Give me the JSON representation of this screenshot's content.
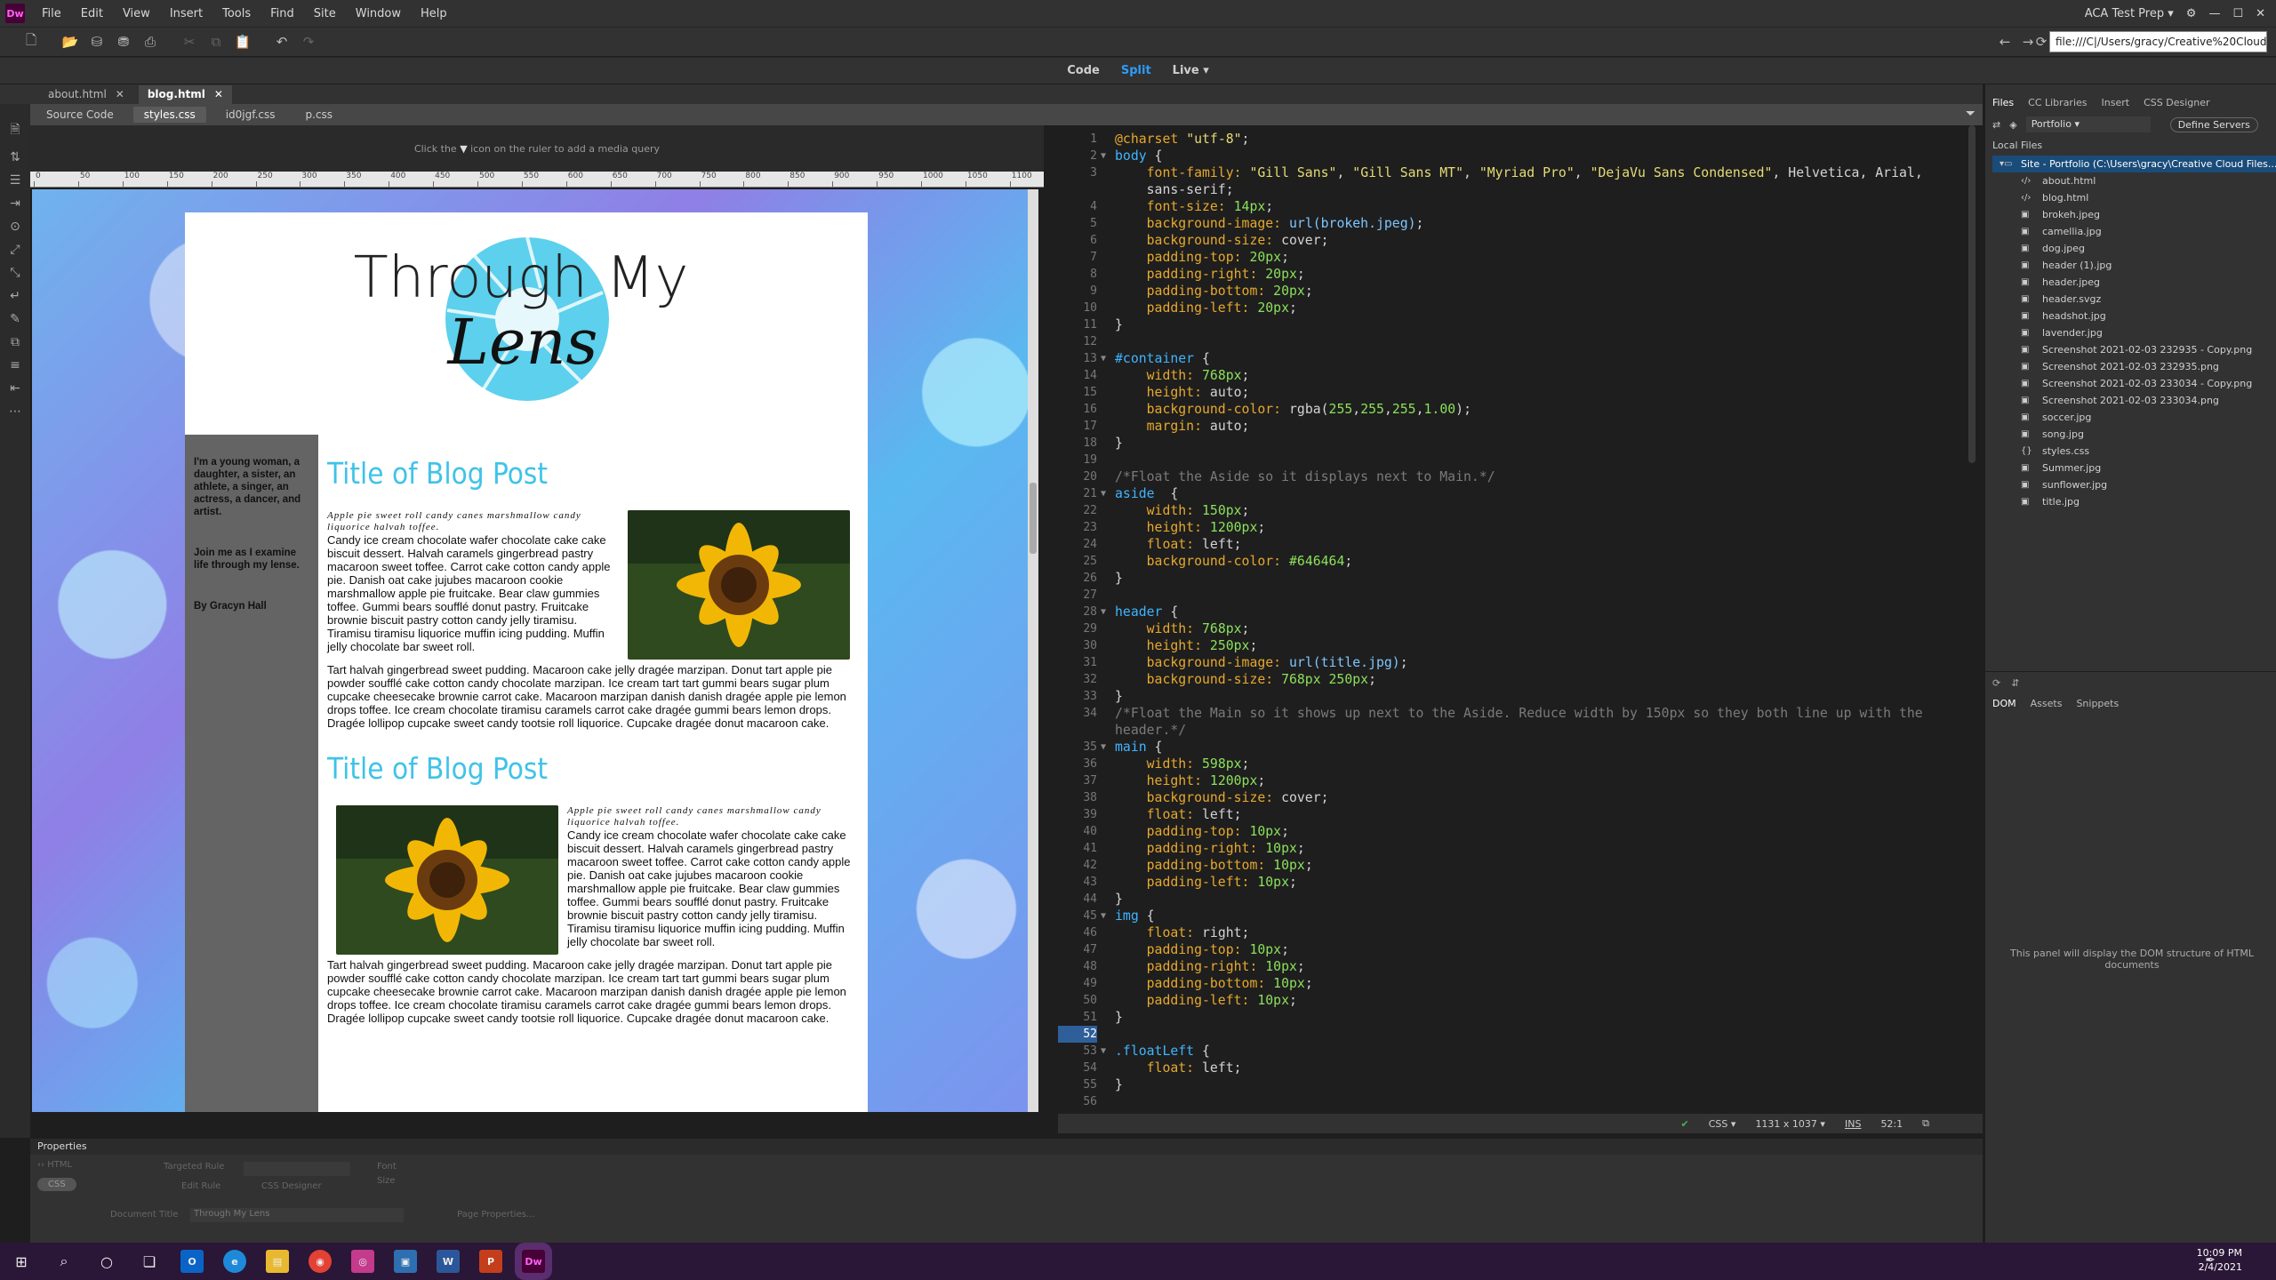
{
  "menu": {
    "items": [
      "File",
      "Edit",
      "View",
      "Insert",
      "Tools",
      "Find",
      "Site",
      "Window",
      "Help"
    ],
    "workspace": "ACA Test Prep"
  },
  "toolbar": {
    "address": "file:///C|/Users/gracy/Creative%20Cloud%2"
  },
  "views": {
    "code": "Code",
    "split": "Split",
    "live": "Live"
  },
  "doc_tabs": [
    {
      "label": "about.html"
    },
    {
      "label": "blog.html"
    }
  ],
  "related": [
    "Source Code",
    "styles.css",
    "id0jgf.css",
    "p.css"
  ],
  "media_query_hint_a": "Click the",
  "media_query_hint_b": "icon on the ruler to add a media query",
  "ruler_ticks": [
    "0",
    "50",
    "100",
    "150",
    "200",
    "250",
    "300",
    "350",
    "400",
    "450",
    "500",
    "550",
    "600",
    "650",
    "700",
    "750",
    "800",
    "850",
    "900",
    "950",
    "1000",
    "1050",
    "1100"
  ],
  "page": {
    "logo_line1": "Through My",
    "logo_line2": "Lens",
    "aside_p1": "I'm a young woman, a daughter, a sister, an athlete, a singer, an actress, a dancer, and artist.",
    "aside_p2": "Join me as I examine life through my lense.",
    "aside_p3": "By Gracyn Hall",
    "post_title": "Title of Blog Post",
    "script_text": "Apple pie sweet roll candy canes marshmallow candy liquorice halvah toffee.",
    "para1": "Candy ice cream chocolate wafer chocolate cake cake biscuit dessert. Halvah caramels gingerbread pastry macaroon sweet toffee. Carrot cake cotton candy apple pie. Danish oat cake jujubes macaroon cookie marshmallow apple pie fruitcake. Bear claw gummies toffee. Gummi bears soufflé donut pastry. Fruitcake brownie biscuit pastry cotton candy jelly tiramisu. Tiramisu tiramisu liquorice muffin icing pudding. Muffin jelly chocolate bar sweet roll.",
    "para2": "Tart halvah gingerbread sweet pudding. Macaroon cake jelly dragée marzipan. Donut tart apple pie powder soufflé cake cotton candy chocolate marzipan. Ice cream tart tart gummi bears sugar plum cupcake cheesecake brownie carrot cake. Macaroon marzipan danish danish dragée apple pie lemon drops toffee. Ice cream chocolate tiramisu caramels carrot cake dragée gummi bears lemon drops. Dragée lollipop cupcake sweet candy tootsie roll liquorice. Cupcake dragée donut macaroon cake."
  },
  "code_lines": [
    [
      {
        "t": "@charset ",
        "c": "pr"
      },
      {
        "t": "\"utf-8\"",
        "c": "s"
      },
      {
        "t": ";",
        "c": "p"
      }
    ],
    [
      {
        "t": "body",
        "c": "k"
      },
      {
        "t": " {",
        "c": "p"
      }
    ],
    [
      {
        "t": "    font-family: ",
        "c": "pr"
      },
      {
        "t": "\"Gill Sans\"",
        "c": "s"
      },
      {
        "t": ", ",
        "c": "p"
      },
      {
        "t": "\"Gill Sans MT\"",
        "c": "s"
      },
      {
        "t": ", ",
        "c": "p"
      },
      {
        "t": "\"Myriad Pro\"",
        "c": "s"
      },
      {
        "t": ", ",
        "c": "p"
      },
      {
        "t": "\"DejaVu Sans Condensed\"",
        "c": "s"
      },
      {
        "t": ", Helvetica, Arial,",
        "c": "p"
      }
    ],
    [
      {
        "t": "    sans-serif;",
        "c": "p"
      }
    ],
    [
      {
        "t": "    font-size: ",
        "c": "pr"
      },
      {
        "t": "14px",
        "c": "n"
      },
      {
        "t": ";",
        "c": "p"
      }
    ],
    [
      {
        "t": "    background-image: ",
        "c": "pr"
      },
      {
        "t": "url(brokeh.jpeg)",
        "c": "f"
      },
      {
        "t": ";",
        "c": "p"
      }
    ],
    [
      {
        "t": "    background-size: ",
        "c": "pr"
      },
      {
        "t": "cover",
        "c": "p"
      },
      {
        "t": ";",
        "c": "p"
      }
    ],
    [
      {
        "t": "    padding-top: ",
        "c": "pr"
      },
      {
        "t": "20px",
        "c": "n"
      },
      {
        "t": ";",
        "c": "p"
      }
    ],
    [
      {
        "t": "    padding-right: ",
        "c": "pr"
      },
      {
        "t": "20px",
        "c": "n"
      },
      {
        "t": ";",
        "c": "p"
      }
    ],
    [
      {
        "t": "    padding-bottom: ",
        "c": "pr"
      },
      {
        "t": "20px",
        "c": "n"
      },
      {
        "t": ";",
        "c": "p"
      }
    ],
    [
      {
        "t": "    padding-left: ",
        "c": "pr"
      },
      {
        "t": "20px",
        "c": "n"
      },
      {
        "t": ";",
        "c": "p"
      }
    ],
    [
      {
        "t": "}",
        "c": "p"
      }
    ],
    [],
    [
      {
        "t": "#container",
        "c": "k"
      },
      {
        "t": " {",
        "c": "p"
      }
    ],
    [
      {
        "t": "    width: ",
        "c": "pr"
      },
      {
        "t": "768px",
        "c": "n"
      },
      {
        "t": ";",
        "c": "p"
      }
    ],
    [
      {
        "t": "    height: ",
        "c": "pr"
      },
      {
        "t": "auto",
        "c": "p"
      },
      {
        "t": ";",
        "c": "p"
      }
    ],
    [
      {
        "t": "    background-color: ",
        "c": "pr"
      },
      {
        "t": "rgba(",
        "c": "p"
      },
      {
        "t": "255",
        "c": "n"
      },
      {
        "t": ",",
        "c": "p"
      },
      {
        "t": "255",
        "c": "n"
      },
      {
        "t": ",",
        "c": "p"
      },
      {
        "t": "255",
        "c": "n"
      },
      {
        "t": ",",
        "c": "p"
      },
      {
        "t": "1.00",
        "c": "n"
      },
      {
        "t": ");",
        "c": "p"
      }
    ],
    [
      {
        "t": "    margin: ",
        "c": "pr"
      },
      {
        "t": "auto",
        "c": "p"
      },
      {
        "t": ";",
        "c": "p"
      }
    ],
    [
      {
        "t": "}",
        "c": "p"
      }
    ],
    [],
    [
      {
        "t": "/*Float the Aside so it displays next to Main.*/",
        "c": "c"
      }
    ],
    [
      {
        "t": "aside",
        "c": "k"
      },
      {
        "t": "  {",
        "c": "p"
      }
    ],
    [
      {
        "t": "    width: ",
        "c": "pr"
      },
      {
        "t": "150px",
        "c": "n"
      },
      {
        "t": ";",
        "c": "p"
      }
    ],
    [
      {
        "t": "    height: ",
        "c": "pr"
      },
      {
        "t": "1200px",
        "c": "n"
      },
      {
        "t": ";",
        "c": "p"
      }
    ],
    [
      {
        "t": "    float: ",
        "c": "pr"
      },
      {
        "t": "left",
        "c": "p"
      },
      {
        "t": ";",
        "c": "p"
      }
    ],
    [
      {
        "t": "    background-color: ",
        "c": "pr"
      },
      {
        "t": "#646464",
        "c": "n"
      },
      {
        "t": ";",
        "c": "p"
      }
    ],
    [
      {
        "t": "}",
        "c": "p"
      }
    ],
    [],
    [
      {
        "t": "header",
        "c": "k"
      },
      {
        "t": " {",
        "c": "p"
      }
    ],
    [
      {
        "t": "    width: ",
        "c": "pr"
      },
      {
        "t": "768px",
        "c": "n"
      },
      {
        "t": ";",
        "c": "p"
      }
    ],
    [
      {
        "t": "    height: ",
        "c": "pr"
      },
      {
        "t": "250px",
        "c": "n"
      },
      {
        "t": ";",
        "c": "p"
      }
    ],
    [
      {
        "t": "    background-image: ",
        "c": "pr"
      },
      {
        "t": "url(title.jpg)",
        "c": "f"
      },
      {
        "t": ";",
        "c": "p"
      }
    ],
    [
      {
        "t": "    background-size: ",
        "c": "pr"
      },
      {
        "t": "768px 250px",
        "c": "n"
      },
      {
        "t": ";",
        "c": "p"
      }
    ],
    [
      {
        "t": "}",
        "c": "p"
      }
    ],
    [
      {
        "t": "/*Float the Main so it shows up next to the Aside. Reduce width by 150px so they both line up with the",
        "c": "c"
      }
    ],
    [
      {
        "t": "header.*/",
        "c": "c"
      }
    ],
    [
      {
        "t": "main",
        "c": "k"
      },
      {
        "t": " {",
        "c": "p"
      }
    ],
    [
      {
        "t": "    width: ",
        "c": "pr"
      },
      {
        "t": "598px",
        "c": "n"
      },
      {
        "t": ";",
        "c": "p"
      }
    ],
    [
      {
        "t": "    height: ",
        "c": "pr"
      },
      {
        "t": "1200px",
        "c": "n"
      },
      {
        "t": ";",
        "c": "p"
      }
    ],
    [
      {
        "t": "    background-size: ",
        "c": "pr"
      },
      {
        "t": "cover",
        "c": "p"
      },
      {
        "t": ";",
        "c": "p"
      }
    ],
    [
      {
        "t": "    float: ",
        "c": "pr"
      },
      {
        "t": "left",
        "c": "p"
      },
      {
        "t": ";",
        "c": "p"
      }
    ],
    [
      {
        "t": "    padding-top: ",
        "c": "pr"
      },
      {
        "t": "10px",
        "c": "n"
      },
      {
        "t": ";",
        "c": "p"
      }
    ],
    [
      {
        "t": "    padding-right: ",
        "c": "pr"
      },
      {
        "t": "10px",
        "c": "n"
      },
      {
        "t": ";",
        "c": "p"
      }
    ],
    [
      {
        "t": "    padding-bottom: ",
        "c": "pr"
      },
      {
        "t": "10px",
        "c": "n"
      },
      {
        "t": ";",
        "c": "p"
      }
    ],
    [
      {
        "t": "    padding-left: ",
        "c": "pr"
      },
      {
        "t": "10px",
        "c": "n"
      },
      {
        "t": ";",
        "c": "p"
      }
    ],
    [
      {
        "t": "}",
        "c": "p"
      }
    ],
    [
      {
        "t": "img",
        "c": "k"
      },
      {
        "t": " {",
        "c": "p"
      }
    ],
    [
      {
        "t": "    float: ",
        "c": "pr"
      },
      {
        "t": "right",
        "c": "p"
      },
      {
        "t": ";",
        "c": "p"
      }
    ],
    [
      {
        "t": "    padding-top: ",
        "c": "pr"
      },
      {
        "t": "10px",
        "c": "n"
      },
      {
        "t": ";",
        "c": "p"
      }
    ],
    [
      {
        "t": "    padding-right: ",
        "c": "pr"
      },
      {
        "t": "10px",
        "c": "n"
      },
      {
        "t": ";",
        "c": "p"
      }
    ],
    [
      {
        "t": "    padding-bottom: ",
        "c": "pr"
      },
      {
        "t": "10px",
        "c": "n"
      },
      {
        "t": ";",
        "c": "p"
      }
    ],
    [
      {
        "t": "    padding-left: ",
        "c": "pr"
      },
      {
        "t": "10px",
        "c": "n"
      },
      {
        "t": ";",
        "c": "p"
      }
    ],
    [
      {
        "t": "}",
        "c": "p"
      }
    ],
    [],
    [
      {
        "t": ".floatLeft",
        "c": "k"
      },
      {
        "t": " {",
        "c": "p"
      }
    ],
    [
      {
        "t": "    float: ",
        "c": "pr"
      },
      {
        "t": "left",
        "c": "p"
      },
      {
        "t": ";",
        "c": "p"
      }
    ],
    [
      {
        "t": "}",
        "c": "p"
      }
    ],
    []
  ],
  "code_line_numbers": [
    "1",
    "2",
    "3",
    "",
    "4",
    "5",
    "6",
    "7",
    "8",
    "9",
    "10",
    "11",
    "12",
    "13",
    "14",
    "15",
    "16",
    "17",
    "18",
    "19",
    "20",
    "21",
    "22",
    "23",
    "24",
    "25",
    "26",
    "27",
    "28",
    "29",
    "30",
    "31",
    "32",
    "33",
    "34",
    "",
    "35",
    "36",
    "37",
    "38",
    "39",
    "40",
    "41",
    "42",
    "43",
    "44",
    "45",
    "46",
    "47",
    "48",
    "49",
    "50",
    "51",
    "52",
    "53",
    "54",
    "55",
    "56"
  ],
  "current_line": "52",
  "status": {
    "language": "CSS",
    "size": "1131 x 1037",
    "mode": "INS",
    "position": "52:1"
  },
  "properties": {
    "title": "Properties",
    "html": "HTML",
    "css": "CSS",
    "doc_title_label": "Document Title",
    "doc_title": "Through My Lens",
    "page_props": "Page Properties...",
    "targeted_rule": "Targeted Rule",
    "font": "Font",
    "edit_rule": "Edit Rule",
    "css_designer": "CSS Designer",
    "size": "Size"
  },
  "files_panel": {
    "tabs": [
      "Files",
      "CC Libraries",
      "Insert",
      "CSS Designer"
    ],
    "site_select": "Portfolio",
    "define_servers": "Define Servers",
    "local_files": "Local Files",
    "site_root": "Site - Portfolio (C:\\Users\\gracy\\Creative Cloud Files...",
    "files": [
      "about.html",
      "blog.html",
      "brokeh.jpeg",
      "camellia.jpg",
      "dog.jpeg",
      "header (1).jpg",
      "header.jpeg",
      "header.svgz",
      "headshot.jpg",
      "lavender.jpg",
      "Screenshot 2021-02-03 232935 - Copy.png",
      "Screenshot 2021-02-03 232935.png",
      "Screenshot 2021-02-03 233034 - Copy.png",
      "Screenshot 2021-02-03 233034.png",
      "soccer.jpg",
      "song.jpg",
      "styles.css",
      "Summer.jpg",
      "sunflower.jpg",
      "title.jpg"
    ]
  },
  "dom_panel": {
    "tabs": [
      "DOM",
      "Assets",
      "Snippets"
    ],
    "message": "This panel will display the DOM structure of HTML documents"
  },
  "clock": {
    "time": "10:09 PM",
    "date": "2/4/2021"
  },
  "colors": {
    "accent": "#2d9cfa",
    "title_blue": "#3fc3e8",
    "aside_gray": "#646464",
    "taskbar": "#2a1636"
  }
}
